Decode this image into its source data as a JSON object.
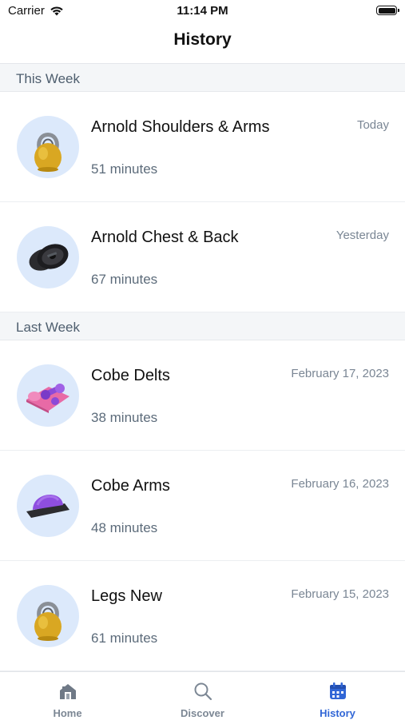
{
  "status_bar": {
    "carrier": "Carrier",
    "time": "11:14 PM"
  },
  "header": {
    "title": "History"
  },
  "sections": [
    {
      "title": "This Week",
      "items": [
        {
          "title": "Arnold Shoulders & Arms",
          "duration": "51 minutes",
          "date": "Today",
          "image": "kettlebell-image"
        },
        {
          "title": "Arnold Chest & Back",
          "duration": "67 minutes",
          "date": "Yesterday",
          "image": "weight-plates-image"
        }
      ]
    },
    {
      "title": "Last Week",
      "items": [
        {
          "title": "Cobe Delts",
          "duration": "38 minutes",
          "date": "February 17, 2023",
          "image": "yoga-mat-dumbbells-image"
        },
        {
          "title": "Cobe Arms",
          "duration": "48 minutes",
          "date": "February 16, 2023",
          "image": "bosu-ball-image"
        },
        {
          "title": "Legs New",
          "duration": "61 minutes",
          "date": "February 15, 2023",
          "image": "kettlebell-image"
        }
      ]
    }
  ],
  "tab_bar": {
    "tabs": [
      {
        "label": "Home",
        "icon": "home-icon",
        "active": false
      },
      {
        "label": "Discover",
        "icon": "search-icon",
        "active": false
      },
      {
        "label": "History",
        "icon": "calendar-icon",
        "active": true
      }
    ],
    "active_color": "#3166d6",
    "inactive_color": "#7c8794"
  }
}
